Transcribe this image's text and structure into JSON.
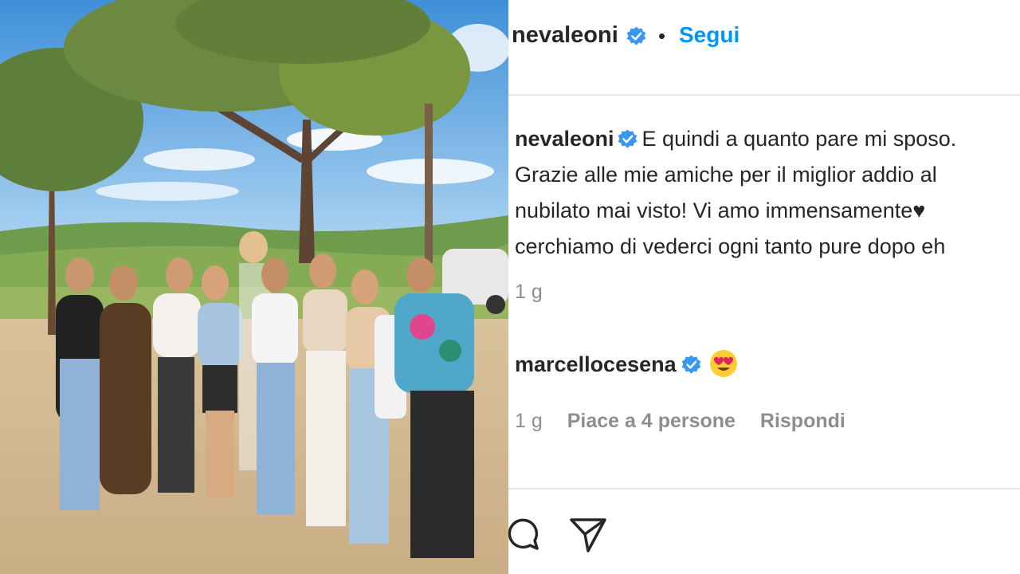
{
  "post": {
    "username": "nevaleoni",
    "follow_label": "Segui",
    "separator": "•"
  },
  "caption": {
    "username": "nevaleoni",
    "lines": [
      "E quindi a quanto pare mi sposo.",
      "Grazie alle mie amiche per il miglior addio al",
      "nubilato mai visto! Vi amo immensamente♥",
      "cerchiamo di vederci ogni tanto pure dopo eh"
    ],
    "time": "1 g"
  },
  "comment": {
    "username": "marcellocesena",
    "emoji": "star-struck-heart-eyes",
    "time": "1 g",
    "likes": "Piace a 4 persone",
    "reply_label": "Rispondi"
  },
  "icons": [
    "verified-badge-icon",
    "comment-icon",
    "share-icon"
  ],
  "colors": {
    "accent": "#0095f6",
    "verified": "#3897f0",
    "text": "#262626",
    "muted": "#8e8e8e"
  }
}
